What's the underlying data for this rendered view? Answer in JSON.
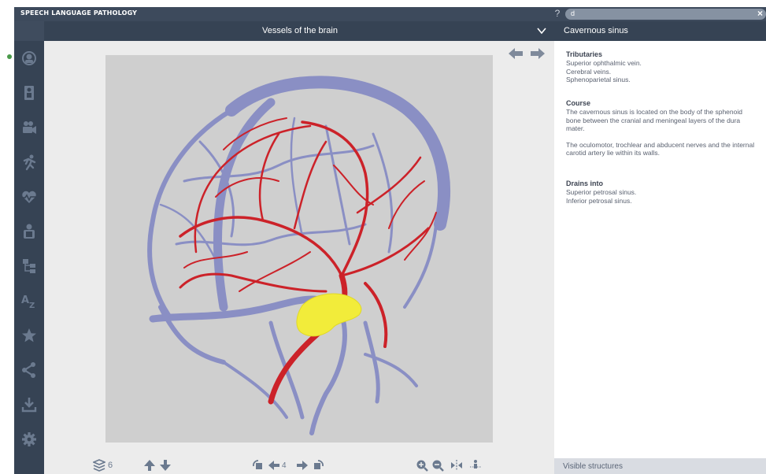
{
  "app": {
    "title": "SPEECH LANGUAGE PATHOLOGY",
    "help_symbol": "?",
    "search_value": "d",
    "close_symbol": "×"
  },
  "viewer": {
    "title": "Vessels of the brain",
    "layers_count": "6",
    "step_count": "4"
  },
  "sidebar": {
    "items": [
      {
        "name": "anatomy-icon"
      },
      {
        "name": "body-systems-icon"
      },
      {
        "name": "video-icon"
      },
      {
        "name": "movement-icon"
      },
      {
        "name": "pathology-icon"
      },
      {
        "name": "quiz-icon"
      },
      {
        "name": "structures-tree-icon"
      },
      {
        "name": "a-z-index-icon"
      },
      {
        "name": "favorites-star-icon"
      },
      {
        "name": "share-icon"
      },
      {
        "name": "download-icon"
      },
      {
        "name": "settings-icon"
      }
    ]
  },
  "info": {
    "title": "Cavernous sinus",
    "tributaries_heading": "Tributaries",
    "tributaries": [
      "Superior ophthalmic vein.",
      "Cerebral veins.",
      "Sphenoparietal sinus."
    ],
    "course_heading": "Course",
    "course_p1": "The cavernous sinus is located on the body of the sphenoid bone between the cranial and meningeal layers of the dura mater.",
    "course_p2": "The oculomotor, trochlear and abducent nerves and the internal carotid artery lie within its walls.",
    "drains_heading": "Drains into",
    "drains": [
      "Superior petrosal sinus.",
      "Inferior petrosal sinus."
    ],
    "visible_structures_label": "Visible structures"
  },
  "colors": {
    "dark_bar": "#364354",
    "vein": "#8a8fc4",
    "artery": "#cc2229",
    "highlight": "#f2ec3a",
    "icon": "#6b7a8f"
  }
}
